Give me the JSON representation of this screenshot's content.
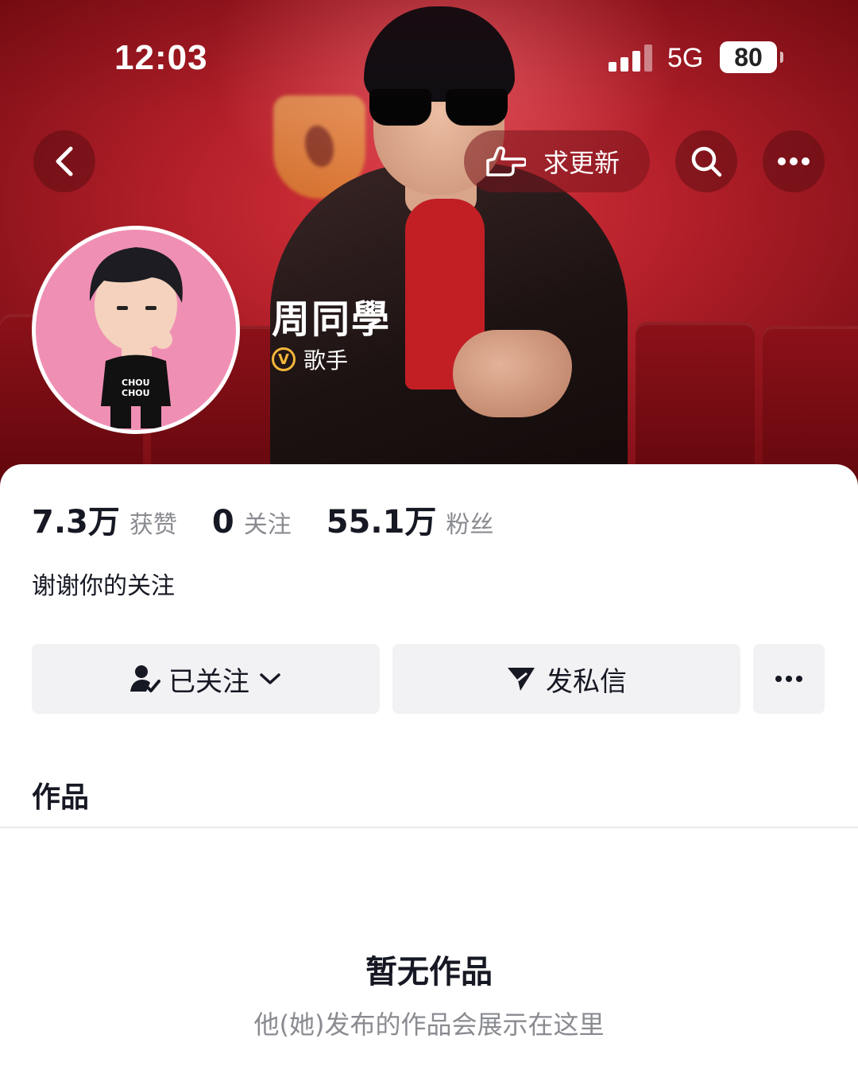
{
  "status_bar": {
    "time": "12:03",
    "network": "5G",
    "battery": "80"
  },
  "header": {
    "update_request_label": "求更新",
    "profile": {
      "name": "周同學",
      "tag": "歌手",
      "badge_letter": "V"
    }
  },
  "stats": [
    {
      "value": "7.3万",
      "label": "获赞"
    },
    {
      "value": "0",
      "label": "关注"
    },
    {
      "value": "55.1万",
      "label": "粉丝"
    }
  ],
  "bio": "谢谢你的关注",
  "actions": {
    "follow_label": "已关注",
    "message_label": "发私信"
  },
  "tab": {
    "label": "作品"
  },
  "empty_state": {
    "title": "暂无作品",
    "subtitle": "他(她)发布的作品会展示在这里"
  },
  "colors": {
    "accent_red": "#b4202a",
    "badge_gold": "#f5b73a",
    "text_primary": "#161823",
    "text_secondary": "#8a8b91",
    "avatar_bg": "#f08fb4"
  },
  "icons": [
    "back-icon",
    "pointing-hand-icon",
    "search-icon",
    "more-icon",
    "verified-v-icon",
    "user-check-icon",
    "chevron-down-icon",
    "send-icon"
  ]
}
